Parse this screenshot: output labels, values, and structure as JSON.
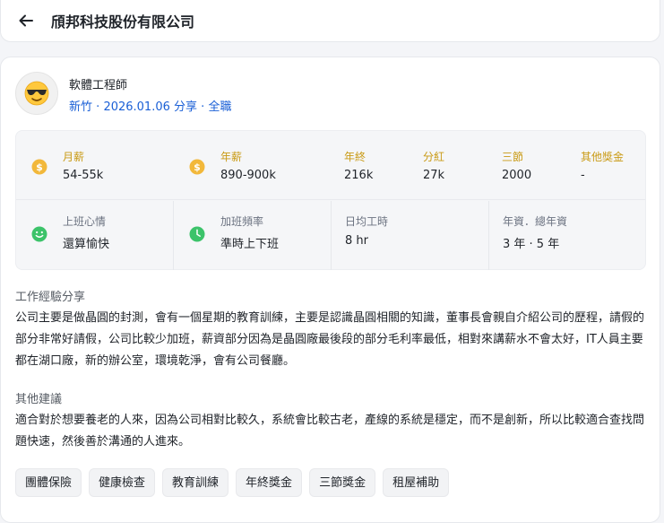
{
  "header": {
    "company_name": "頎邦科技股份有限公司"
  },
  "job": {
    "title": "軟體工程師",
    "location": "新竹",
    "date": "2026.01.06",
    "share_label": "分享",
    "employment_type": "全職",
    "separator": "·"
  },
  "compensation": [
    {
      "label": "月薪",
      "value": "54-55k"
    },
    {
      "label": "年薪",
      "value": "890-900k"
    },
    {
      "label": "年終",
      "value": "216k"
    },
    {
      "label": "分紅",
      "value": "27k"
    },
    {
      "label": "三節",
      "value": "2000"
    },
    {
      "label": "其他獎金",
      "value": "-"
    }
  ],
  "work_stats": [
    {
      "label": "上班心情",
      "value": "還算愉快"
    },
    {
      "label": "加班頻率",
      "value": "準時上下班"
    },
    {
      "label": "日均工時",
      "value": "8 hr"
    },
    {
      "label": "年資．總年資",
      "value": "3 年 ‧ 5 年"
    }
  ],
  "experience": {
    "heading": "工作經驗分享",
    "text": "公司主要是做晶圓的封測，會有一個星期的教育訓練，主要是認識晶圓相關的知識，董事長會親自介紹公司的歷程，請假的部分非常好請假，公司比較少加班，薪資部分因為是晶圓廠最後段的部分毛利率最低，相對來講薪水不會太好，IT人員主要都在湖口廠，新的辦公室，環境乾淨，會有公司餐廳。"
  },
  "suggestion": {
    "heading": "其他建議",
    "text": "適合對於想要養老的人來，因為公司相對比較久，系統會比較古老，產線的系統是穩定，而不是創新，所以比較適合查找問題快速，然後善於溝通的人進來。"
  },
  "benefits": [
    "團體保險",
    "健康檢查",
    "教育訓練",
    "年終獎金",
    "三節獎金",
    "租屋補助"
  ],
  "colors": {
    "accent": "#1a5fd6",
    "gold": "#c99a14",
    "mood_green": "#3cc36a"
  }
}
